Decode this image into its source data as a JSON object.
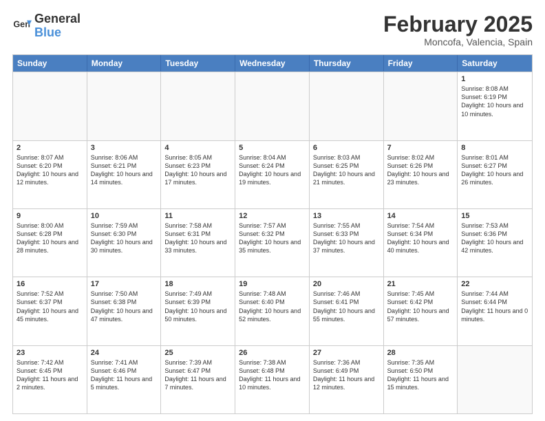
{
  "logo": {
    "line1": "General",
    "line2": "Blue"
  },
  "header": {
    "month": "February 2025",
    "location": "Moncofa, Valencia, Spain"
  },
  "days": [
    "Sunday",
    "Monday",
    "Tuesday",
    "Wednesday",
    "Thursday",
    "Friday",
    "Saturday"
  ],
  "weeks": [
    [
      {
        "day": "",
        "text": ""
      },
      {
        "day": "",
        "text": ""
      },
      {
        "day": "",
        "text": ""
      },
      {
        "day": "",
        "text": ""
      },
      {
        "day": "",
        "text": ""
      },
      {
        "day": "",
        "text": ""
      },
      {
        "day": "1",
        "text": "Sunrise: 8:08 AM\nSunset: 6:19 PM\nDaylight: 10 hours and 10 minutes."
      }
    ],
    [
      {
        "day": "2",
        "text": "Sunrise: 8:07 AM\nSunset: 6:20 PM\nDaylight: 10 hours and 12 minutes."
      },
      {
        "day": "3",
        "text": "Sunrise: 8:06 AM\nSunset: 6:21 PM\nDaylight: 10 hours and 14 minutes."
      },
      {
        "day": "4",
        "text": "Sunrise: 8:05 AM\nSunset: 6:23 PM\nDaylight: 10 hours and 17 minutes."
      },
      {
        "day": "5",
        "text": "Sunrise: 8:04 AM\nSunset: 6:24 PM\nDaylight: 10 hours and 19 minutes."
      },
      {
        "day": "6",
        "text": "Sunrise: 8:03 AM\nSunset: 6:25 PM\nDaylight: 10 hours and 21 minutes."
      },
      {
        "day": "7",
        "text": "Sunrise: 8:02 AM\nSunset: 6:26 PM\nDaylight: 10 hours and 23 minutes."
      },
      {
        "day": "8",
        "text": "Sunrise: 8:01 AM\nSunset: 6:27 PM\nDaylight: 10 hours and 26 minutes."
      }
    ],
    [
      {
        "day": "9",
        "text": "Sunrise: 8:00 AM\nSunset: 6:28 PM\nDaylight: 10 hours and 28 minutes."
      },
      {
        "day": "10",
        "text": "Sunrise: 7:59 AM\nSunset: 6:30 PM\nDaylight: 10 hours and 30 minutes."
      },
      {
        "day": "11",
        "text": "Sunrise: 7:58 AM\nSunset: 6:31 PM\nDaylight: 10 hours and 33 minutes."
      },
      {
        "day": "12",
        "text": "Sunrise: 7:57 AM\nSunset: 6:32 PM\nDaylight: 10 hours and 35 minutes."
      },
      {
        "day": "13",
        "text": "Sunrise: 7:55 AM\nSunset: 6:33 PM\nDaylight: 10 hours and 37 minutes."
      },
      {
        "day": "14",
        "text": "Sunrise: 7:54 AM\nSunset: 6:34 PM\nDaylight: 10 hours and 40 minutes."
      },
      {
        "day": "15",
        "text": "Sunrise: 7:53 AM\nSunset: 6:36 PM\nDaylight: 10 hours and 42 minutes."
      }
    ],
    [
      {
        "day": "16",
        "text": "Sunrise: 7:52 AM\nSunset: 6:37 PM\nDaylight: 10 hours and 45 minutes."
      },
      {
        "day": "17",
        "text": "Sunrise: 7:50 AM\nSunset: 6:38 PM\nDaylight: 10 hours and 47 minutes."
      },
      {
        "day": "18",
        "text": "Sunrise: 7:49 AM\nSunset: 6:39 PM\nDaylight: 10 hours and 50 minutes."
      },
      {
        "day": "19",
        "text": "Sunrise: 7:48 AM\nSunset: 6:40 PM\nDaylight: 10 hours and 52 minutes."
      },
      {
        "day": "20",
        "text": "Sunrise: 7:46 AM\nSunset: 6:41 PM\nDaylight: 10 hours and 55 minutes."
      },
      {
        "day": "21",
        "text": "Sunrise: 7:45 AM\nSunset: 6:42 PM\nDaylight: 10 hours and 57 minutes."
      },
      {
        "day": "22",
        "text": "Sunrise: 7:44 AM\nSunset: 6:44 PM\nDaylight: 11 hours and 0 minutes."
      }
    ],
    [
      {
        "day": "23",
        "text": "Sunrise: 7:42 AM\nSunset: 6:45 PM\nDaylight: 11 hours and 2 minutes."
      },
      {
        "day": "24",
        "text": "Sunrise: 7:41 AM\nSunset: 6:46 PM\nDaylight: 11 hours and 5 minutes."
      },
      {
        "day": "25",
        "text": "Sunrise: 7:39 AM\nSunset: 6:47 PM\nDaylight: 11 hours and 7 minutes."
      },
      {
        "day": "26",
        "text": "Sunrise: 7:38 AM\nSunset: 6:48 PM\nDaylight: 11 hours and 10 minutes."
      },
      {
        "day": "27",
        "text": "Sunrise: 7:36 AM\nSunset: 6:49 PM\nDaylight: 11 hours and 12 minutes."
      },
      {
        "day": "28",
        "text": "Sunrise: 7:35 AM\nSunset: 6:50 PM\nDaylight: 11 hours and 15 minutes."
      },
      {
        "day": "",
        "text": ""
      }
    ]
  ]
}
